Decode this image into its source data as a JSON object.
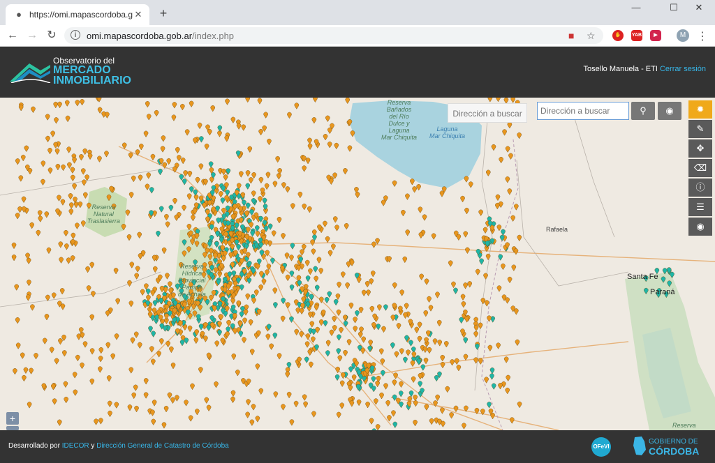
{
  "browser": {
    "tab_title": "https://omi.mapascordoba.gob.a",
    "url_host": "omi.mapascordoba.gob.ar",
    "url_path": "/index.php",
    "ext_labels": [
      "YAB"
    ],
    "profile_initial": "M"
  },
  "header": {
    "logo_line1": "Observatorio del",
    "logo_line2": "MERCADO",
    "logo_line3": "INMOBILIARIO",
    "user": "Tosello Manuela - ETI",
    "logout": "Cerrar sesión"
  },
  "map": {
    "search_hint": "Dirección a buscar",
    "search_placeholder": "Dirección a buscar",
    "zoom_in": "+",
    "labels": {
      "reserva_banados": "Reserva\nBañados\ndel Río\nDulce y\nLaguna\nMar Chiquita",
      "laguna": "Laguna\nMar Chiquita",
      "traslasierra": "Reserva\nNatural\nTraslasierra",
      "pampa_achala": "Reserva\nHídrica\nProvincial\nPampa\nde Achala",
      "rafaela": "Rafaela",
      "santa_fe": "Santa Fe",
      "parana": "Paraná",
      "reserva_bottom": "Reserva"
    },
    "colors": {
      "orange_marker": "#e8961e",
      "teal_marker": "#1fb5a6",
      "lake": "#a9d3df"
    }
  },
  "footer": {
    "credit_prefix": "Desarrollado por",
    "idecor": "IDECOR",
    "and": "y",
    "catastro": "Dirección General de Catastro de Córdoba",
    "ofevi": "OFeVI",
    "gob_line1": "GOBIERNO DE",
    "gob_line2": "CÓRDOBA"
  }
}
